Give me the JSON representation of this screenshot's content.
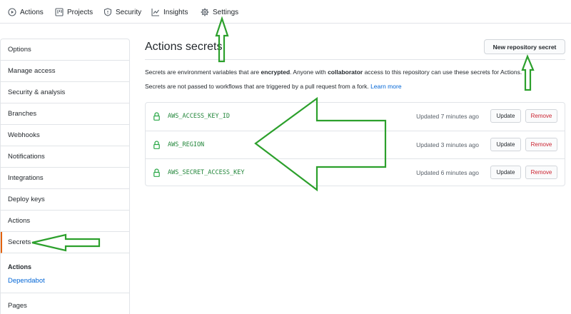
{
  "topnav": {
    "tabs": [
      {
        "label": "Actions",
        "icon": "play-circle-icon"
      },
      {
        "label": "Projects",
        "icon": "project-board-icon"
      },
      {
        "label": "Security",
        "icon": "shield-icon"
      },
      {
        "label": "Insights",
        "icon": "graph-icon"
      },
      {
        "label": "Settings",
        "icon": "gear-icon"
      }
    ]
  },
  "sidebar": {
    "items": [
      {
        "label": "Options"
      },
      {
        "label": "Manage access"
      },
      {
        "label": "Security & analysis"
      },
      {
        "label": "Branches"
      },
      {
        "label": "Webhooks"
      },
      {
        "label": "Notifications"
      },
      {
        "label": "Integrations"
      },
      {
        "label": "Deploy keys"
      },
      {
        "label": "Actions"
      },
      {
        "label": "Secrets",
        "selected": true
      }
    ],
    "section_heading": "Actions",
    "section_link": "Dependabot",
    "bottom_item": "Pages"
  },
  "main": {
    "title": "Actions secrets",
    "new_secret_label": "New repository secret",
    "desc1": {
      "part1": "Secrets are environment variables that are ",
      "bold1": "encrypted",
      "part2": ". Anyone with ",
      "bold2": "collaborator",
      "part3": " access to this repository can use these secrets for Actions."
    },
    "desc2": {
      "text": "Secrets are not passed to workflows that are triggered by a pull request from a fork. ",
      "link": "Learn more"
    },
    "secrets": [
      {
        "name": "AWS_ACCESS_KEY_ID",
        "updated": "Updated 7 minutes ago",
        "update_label": "Update",
        "remove_label": "Remove"
      },
      {
        "name": "AWS_REGION",
        "updated": "Updated 3 minutes ago",
        "update_label": "Update",
        "remove_label": "Remove"
      },
      {
        "name": "AWS_SECRET_ACCESS_KEY",
        "updated": "Updated 6 minutes ago",
        "update_label": "Update",
        "remove_label": "Remove"
      }
    ]
  },
  "colors": {
    "annotation_arrow": "#2ca02c",
    "link": "#0366d6",
    "selected_accent": "#e36209",
    "danger": "#cb2431",
    "secret_name": "#22863a"
  }
}
